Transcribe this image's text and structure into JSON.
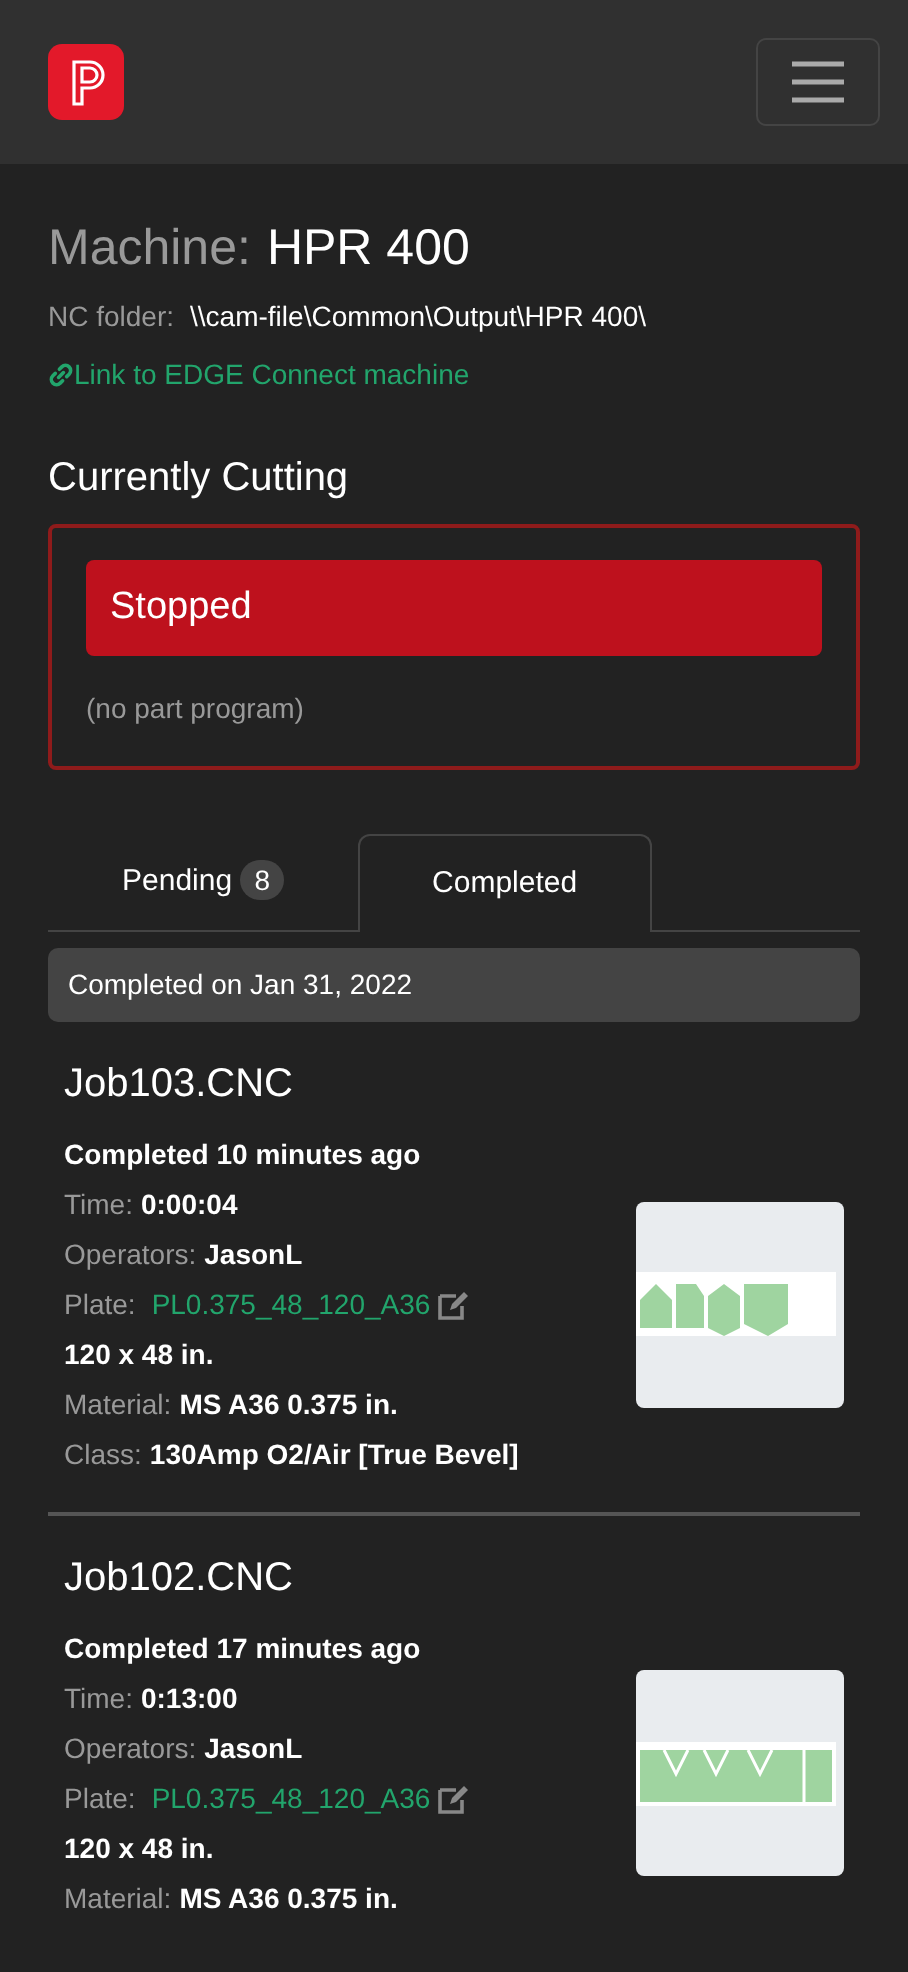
{
  "machine": {
    "label": "Machine:",
    "name": "HPR 400",
    "folder_label": "NC folder:",
    "folder": "\\\\cam-file\\Common\\Output\\HPR 400\\",
    "link": "Link to EDGE Connect machine"
  },
  "current": {
    "heading": "Currently Cutting",
    "status": "Stopped",
    "program": "(no part program)"
  },
  "tabs": [
    {
      "label": "Pending",
      "count": "8",
      "selected": false
    },
    {
      "label": "Completed",
      "selected": true
    }
  ],
  "group_header": "Completed on Jan 31, 2022",
  "jobs": [
    {
      "name": "Job103.CNC",
      "completed": "Completed 10 minutes ago",
      "lines": [
        {
          "kind": "field",
          "label": "Time:",
          "value": "0:00:04"
        },
        {
          "kind": "field",
          "label": "Operators:",
          "value": "JasonL"
        },
        {
          "kind": "link",
          "label": "Plate:",
          "value": "PL0.375_48_120_A36"
        },
        {
          "kind": "plain",
          "value": "120 x 48 in."
        },
        {
          "kind": "field",
          "label": "Material:",
          "value": "MS A36 0.375 in."
        },
        {
          "kind": "field",
          "label": "Class:",
          "value": "130Amp O2/Air [True Bevel]"
        }
      ]
    },
    {
      "name": "Job102.CNC",
      "completed": "Completed 17 minutes ago",
      "lines": [
        {
          "kind": "field",
          "label": "Time:",
          "value": "0:13:00"
        },
        {
          "kind": "field",
          "label": "Operators:",
          "value": "JasonL"
        },
        {
          "kind": "link",
          "label": "Plate:",
          "value": "PL0.375_48_120_A36"
        },
        {
          "kind": "plain",
          "value": "120 x 48 in."
        },
        {
          "kind": "field",
          "label": "Material:",
          "value": "MS A36 0.375 in."
        }
      ]
    }
  ]
}
